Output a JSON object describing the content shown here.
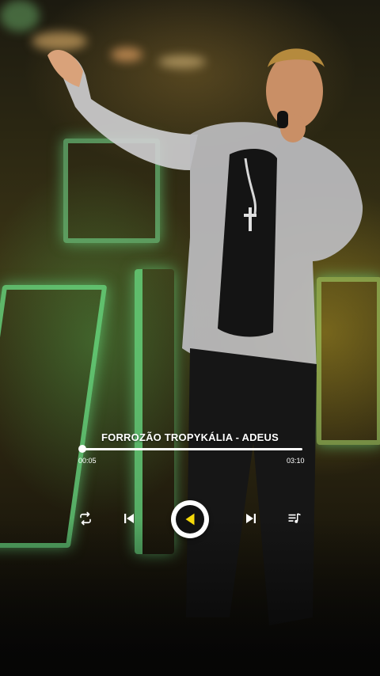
{
  "player": {
    "track_title": "FORROZÃO TROPYKÁLIA - ADEUS",
    "current_time": "00:05",
    "total_time": "03:10",
    "progress": 0.0,
    "accent_color": "#f5d90a"
  },
  "controls": {
    "repeat_icon": "repeat-icon",
    "prev_icon": "skip-previous-icon",
    "play_icon": "play-icon",
    "next_icon": "skip-next-icon",
    "queue_icon": "queue-music-icon"
  }
}
